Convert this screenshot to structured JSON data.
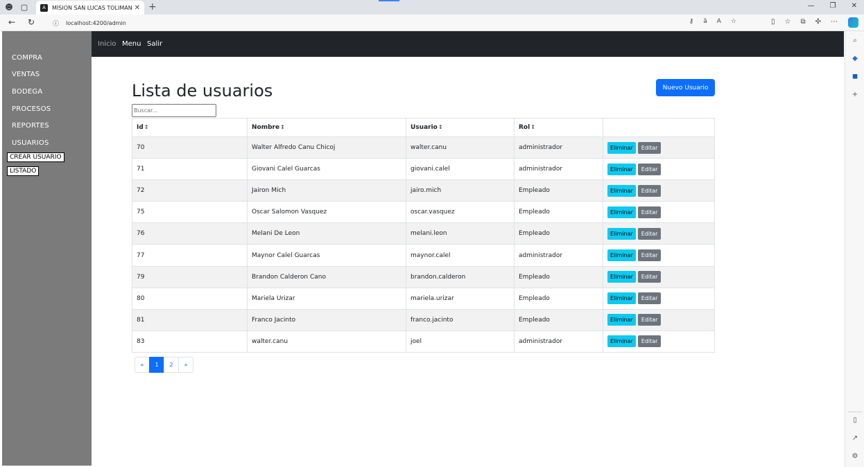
{
  "browser": {
    "tab_title": "MISION SAN LUCAS TOLIMAN",
    "url": "localhost:4200/admin"
  },
  "sidebar": {
    "items": [
      {
        "label": "COMPRA"
      },
      {
        "label": "VENTAS"
      },
      {
        "label": "BODEGA"
      },
      {
        "label": "PROCESOS"
      },
      {
        "label": "REPORTES"
      },
      {
        "label": "USUARIOS"
      }
    ],
    "subitems": [
      {
        "label": "CREAR USUARIO"
      },
      {
        "label": "LISTADO"
      }
    ]
  },
  "topnav": {
    "inicio": "Inicio",
    "menu": "Menu",
    "salir": "Salir"
  },
  "main": {
    "title": "Lista de usuarios",
    "new_button": "Nuevo Usuario",
    "search_placeholder": "Buscar...",
    "columns": [
      "Id",
      "Nombre",
      "Usuario",
      "Rol",
      ""
    ],
    "delete_label": "Eliminar",
    "edit_label": "Editar",
    "rows": [
      {
        "id": "70",
        "nombre": "Walter Alfredo Canu Chicoj",
        "usuario": "walter.canu",
        "rol": "administrador"
      },
      {
        "id": "71",
        "nombre": "Giovani Calel Guarcas",
        "usuario": "giovani.calel",
        "rol": "administrador"
      },
      {
        "id": "72",
        "nombre": "Jairon Mich",
        "usuario": "jairo.mich",
        "rol": "Empleado"
      },
      {
        "id": "75",
        "nombre": "Oscar Salomon Vasquez",
        "usuario": "oscar.vasquez",
        "rol": "Empleado"
      },
      {
        "id": "76",
        "nombre": "Melani De Leon",
        "usuario": "melani.leon",
        "rol": "Empleado"
      },
      {
        "id": "77",
        "nombre": "Maynor Calel Guarcas",
        "usuario": "maynor.calel",
        "rol": "administrador"
      },
      {
        "id": "79",
        "nombre": "Brandon Calderon Cano",
        "usuario": "brandon.calderon",
        "rol": "Empleado"
      },
      {
        "id": "80",
        "nombre": "Mariela Urizar",
        "usuario": "mariela.urizar",
        "rol": "Empleado"
      },
      {
        "id": "81",
        "nombre": "Franco Jacinto",
        "usuario": "franco.jacinto",
        "rol": "Empleado"
      },
      {
        "id": "83",
        "nombre": "walter.canu",
        "usuario": "joel",
        "rol": "administrador"
      }
    ],
    "pagination": {
      "prev": "«",
      "pages": [
        "1",
        "2"
      ],
      "active": "1",
      "next": "»"
    }
  },
  "colors": {
    "sidebar_bg": "#7b7b7b",
    "topnav_bg": "#212529",
    "primary": "#0d6efd",
    "info": "#0dcaf0",
    "secondary": "#6c757d"
  }
}
